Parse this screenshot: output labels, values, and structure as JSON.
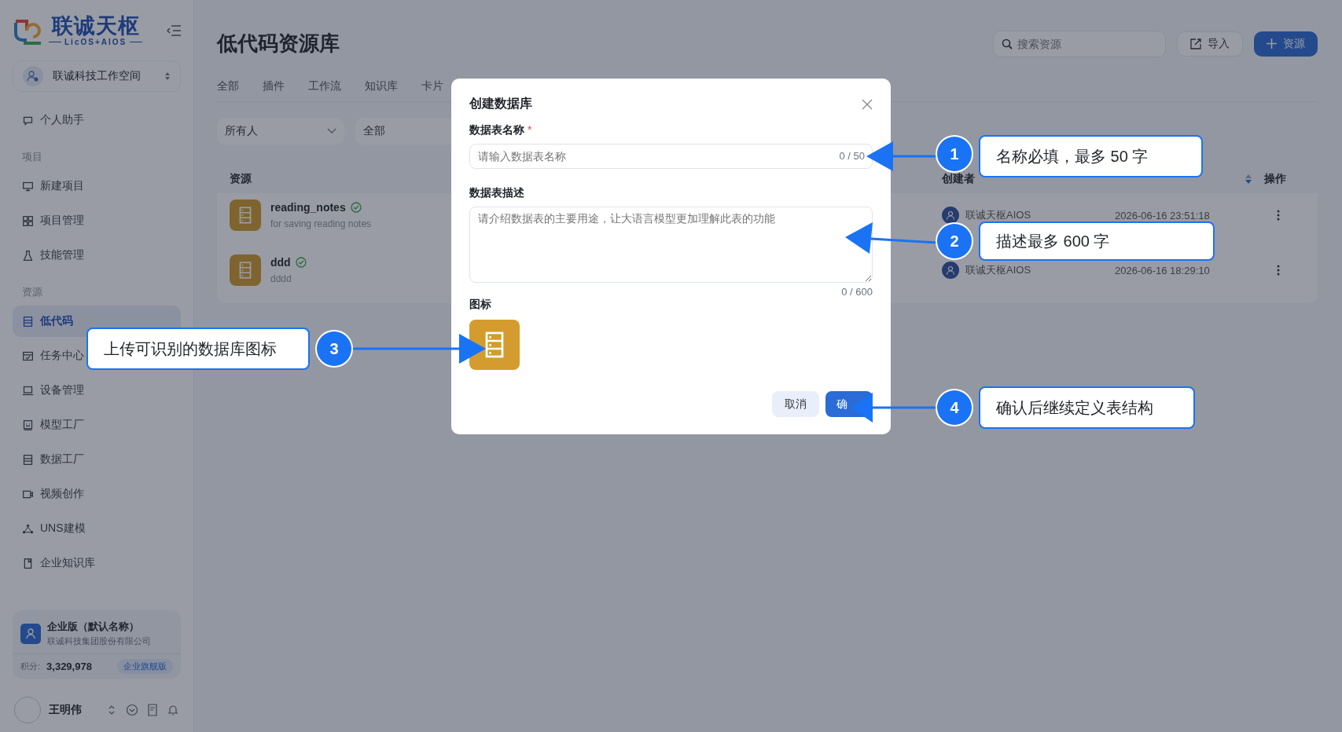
{
  "sidebar": {
    "logo": {
      "name": "联诚天枢",
      "tagline": "LicOS+AIOS"
    },
    "workspace": "联诚科技工作空间",
    "nav": [
      {
        "kind": "item",
        "label": "个人助手",
        "selected": false
      },
      {
        "kind": "section",
        "label": "项目"
      },
      {
        "kind": "item",
        "label": "新建项目",
        "selected": false
      },
      {
        "kind": "item",
        "label": "项目管理",
        "selected": false
      },
      {
        "kind": "item",
        "label": "技能管理",
        "selected": false
      },
      {
        "kind": "section",
        "label": "资源"
      },
      {
        "kind": "item",
        "label": "低代码",
        "selected": true
      },
      {
        "kind": "item",
        "label": "任务中心",
        "selected": false
      },
      {
        "kind": "item",
        "label": "设备管理",
        "selected": false
      },
      {
        "kind": "item",
        "label": "模型工厂",
        "selected": false
      },
      {
        "kind": "item",
        "label": "数据工厂",
        "selected": false
      },
      {
        "kind": "item",
        "label": "视频创作",
        "selected": false
      },
      {
        "kind": "item",
        "label": "UNS建模",
        "selected": false
      },
      {
        "kind": "item",
        "label": "企业知识库",
        "selected": false
      }
    ],
    "plan": {
      "edition": "企业版（默认名称）",
      "company": "联诚科技集团股份有限公司",
      "points_label": "积分:",
      "points": "3,329,978",
      "tier": "企业旗舰版"
    },
    "user": {
      "name": "王明伟"
    }
  },
  "header": {
    "title": "低代码资源库",
    "search": {
      "placeholder": "搜索资源"
    },
    "import_button": "导入",
    "add_button": "资源"
  },
  "tabs": [
    {
      "label": "全部"
    },
    {
      "label": "插件"
    },
    {
      "label": "工作流"
    },
    {
      "label": "知识库"
    },
    {
      "label": "卡片"
    }
  ],
  "filters": [
    {
      "value": "所有人"
    },
    {
      "value": "全部"
    }
  ],
  "table": {
    "columns": [
      {
        "label": "资源"
      },
      {
        "label": "创建者"
      },
      {
        "label": "操作"
      }
    ],
    "rows": [
      {
        "name": "reading_notes",
        "description": "for saving reading notes",
        "verified": true,
        "creator": "联诚天枢AIOS",
        "time": "2026-06-16 23:51:18"
      },
      {
        "name": "ddd",
        "description": "dddd",
        "verified": true,
        "creator": "联诚天枢AIOS",
        "time": "2026-06-16 18:29:10"
      }
    ]
  },
  "dialog": {
    "title": "创建数据库",
    "name_label": "数据表名称",
    "required_mark": "*",
    "name_placeholder": "请输入数据表名称",
    "name_counter": "0 / 50",
    "desc_label": "数据表描述",
    "desc_placeholder": "请介绍数据表的主要用途，让大语言模型更加理解此表的功能",
    "desc_counter": "0 / 600",
    "icon_label": "图标",
    "cancel_button": "取消",
    "confirm_button": "确"
  },
  "callouts": [
    {
      "number": "1",
      "text": "名称必填，最多 50 字"
    },
    {
      "number": "2",
      "text": "描述最多 600 字"
    },
    {
      "number": "3",
      "text": "上传可识别的数据库图标"
    },
    {
      "number": "4",
      "text": "确认后继续定义表结构"
    }
  ]
}
